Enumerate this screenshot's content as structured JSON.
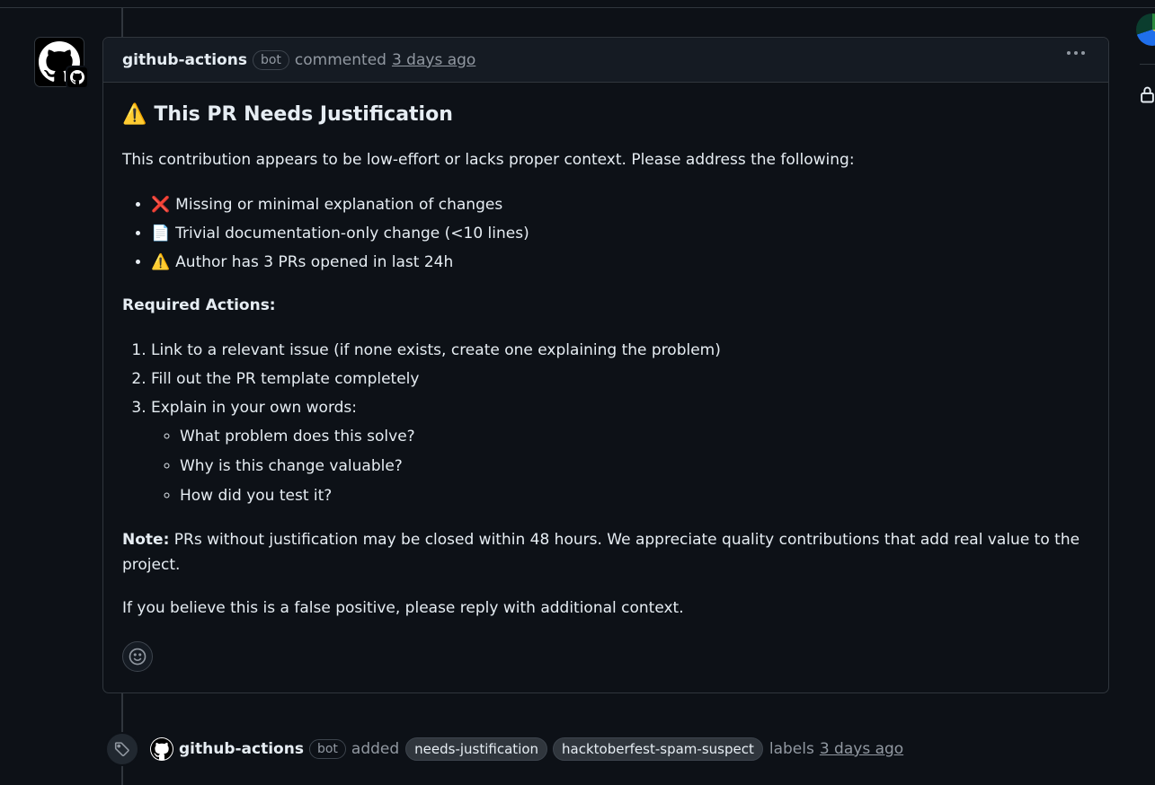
{
  "comment": {
    "author": "github-actions",
    "bot_badge": "bot",
    "action": "commented",
    "time": "3 days ago",
    "heading_emoji": "⚠️",
    "heading": "This PR Needs Justification",
    "intro": "This contribution appears to be low-effort or lacks proper context. Please address the following:",
    "issues": [
      {
        "emoji": "❌",
        "text": "Missing or minimal explanation of changes"
      },
      {
        "emoji": "📄",
        "text": "Trivial documentation-only change (<10 lines)"
      },
      {
        "emoji": "⚠️",
        "text": "Author has 3 PRs opened in last 24h"
      }
    ],
    "required_heading": "Required Actions:",
    "actions": [
      "Link to a relevant issue (if none exists, create one explaining the problem)",
      "Fill out the PR template completely",
      "Explain in your own words:"
    ],
    "sub_actions": [
      "What problem does this solve?",
      "Why is this change valuable?",
      "How did you test it?"
    ],
    "note_label": "Note:",
    "note_text": " PRs without justification may be closed within 48 hours. We appreciate quality contributions that add real value to the project.",
    "closing": "If you believe this is a false positive, please reply with additional context."
  },
  "event": {
    "actor": "github-actions",
    "bot_badge": "bot",
    "action": "added",
    "labels": [
      "needs-justification",
      "hacktoberfest-spam-suspect"
    ],
    "suffix": "labels",
    "time": "3 days ago"
  },
  "icons": {
    "avatar": "github-mark-icon",
    "reaction": "smiley-icon",
    "menu": "kebab-horizontal-icon",
    "event": "tag-icon",
    "sidebar": "lock-icon"
  }
}
